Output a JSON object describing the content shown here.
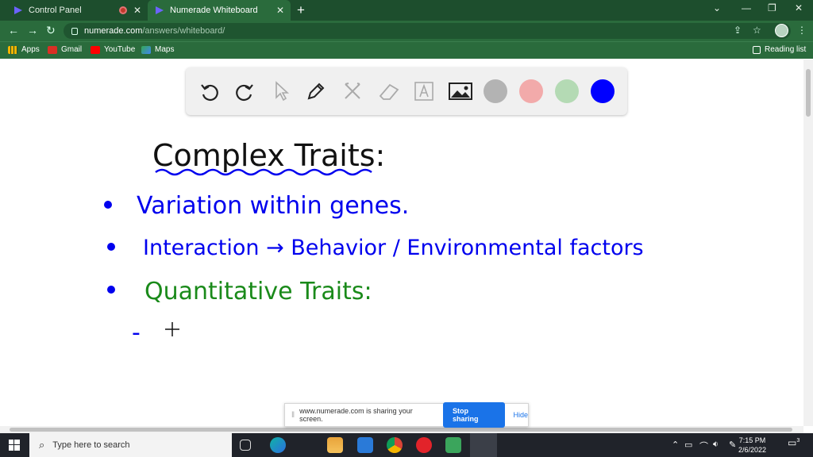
{
  "tabs": [
    {
      "label": "Control Panel"
    },
    {
      "label": "Numerade Whiteboard"
    }
  ],
  "address": {
    "host": "numerade.com",
    "path": "/answers/whiteboard/"
  },
  "bookmarks": [
    {
      "label": "Apps"
    },
    {
      "label": "Gmail"
    },
    {
      "label": "YouTube"
    },
    {
      "label": "Maps"
    }
  ],
  "reading_list": "Reading list",
  "whiteboard": {
    "tools": [
      "undo-icon",
      "redo-icon",
      "pointer-icon",
      "pen-icon",
      "tools-icon",
      "eraser-icon",
      "text-icon",
      "image-icon"
    ],
    "colors": [
      "#b3b3b3",
      "#f2aaaa",
      "#b4dab4",
      "#0000ff"
    ],
    "handwriting": {
      "heading": "Complex Traits:",
      "line1": "Variation within genes.",
      "line2": "Interaction → Behavior / Environmental factors",
      "line3": "Quantitative Traits:",
      "line4": "-"
    }
  },
  "share_bar": {
    "message": "www.numerade.com is sharing your screen.",
    "stop": "Stop sharing",
    "hide": "Hide"
  },
  "taskbar": {
    "search_placeholder": "Type here to search",
    "time": "7:15 PM",
    "date": "2/6/2022",
    "notifications": "3"
  }
}
